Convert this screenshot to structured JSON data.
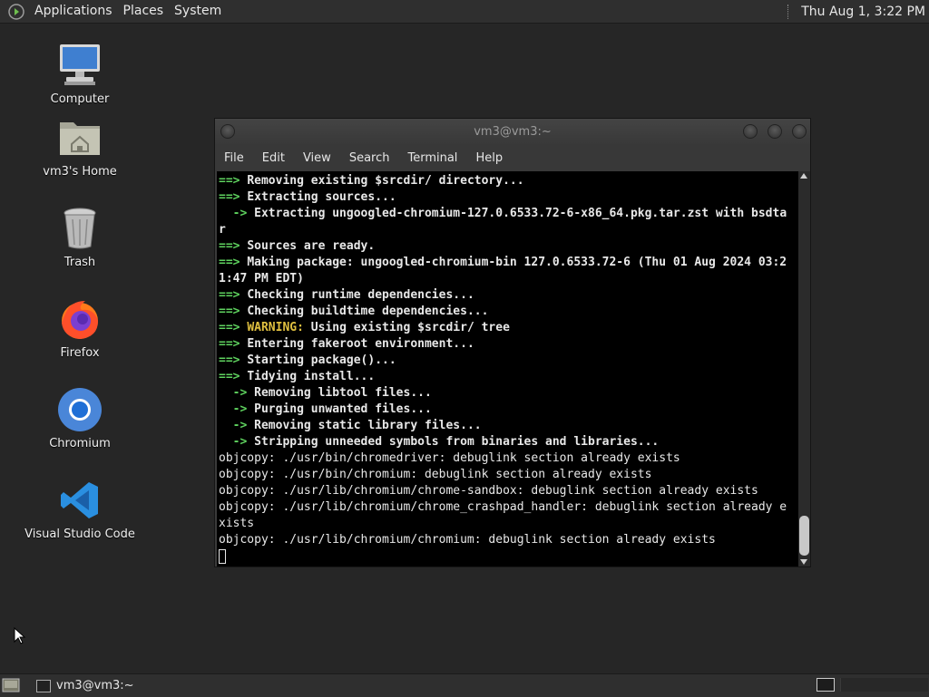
{
  "top_panel": {
    "menus": [
      "Applications",
      "Places",
      "System"
    ],
    "clock": "Thu Aug  1,  3:22 PM"
  },
  "desktop_icons": [
    {
      "label": "Computer",
      "icon": "computer-icon"
    },
    {
      "label": "vm3's Home",
      "icon": "home-folder-icon"
    },
    {
      "label": "Trash",
      "icon": "trash-icon"
    },
    {
      "label": "Firefox",
      "icon": "firefox-icon"
    },
    {
      "label": "Chromium",
      "icon": "chromium-icon"
    },
    {
      "label": "Visual Studio Code",
      "icon": "vscode-icon"
    }
  ],
  "terminal": {
    "title": "vm3@vm3:~",
    "menu": [
      "File",
      "Edit",
      "View",
      "Search",
      "Terminal",
      "Help"
    ],
    "lines": [
      {
        "prefix": "==> ",
        "kind": "main",
        "text": "Removing existing $srcdir/ directory..."
      },
      {
        "prefix": "==> ",
        "kind": "main",
        "text": "Extracting sources..."
      },
      {
        "prefix": "  -> ",
        "kind": "sub",
        "text": "Extracting ungoogled-chromium-127.0.6533.72-6-x86_64.pkg.tar.zst with bsdta"
      },
      {
        "prefix": "",
        "kind": "cont",
        "text": "r"
      },
      {
        "prefix": "==> ",
        "kind": "main",
        "text": "Sources are ready."
      },
      {
        "prefix": "==> ",
        "kind": "main",
        "text": "Making package: ungoogled-chromium-bin 127.0.6533.72-6 (Thu 01 Aug 2024 03:2"
      },
      {
        "prefix": "",
        "kind": "cont",
        "text": "1:47 PM EDT)"
      },
      {
        "prefix": "==> ",
        "kind": "main",
        "text": "Checking runtime dependencies..."
      },
      {
        "prefix": "==> ",
        "kind": "main",
        "text": "Checking buildtime dependencies..."
      },
      {
        "prefix": "==> ",
        "kind": "warning",
        "warn_label": "WARNING:",
        "text": " Using existing $srcdir/ tree"
      },
      {
        "prefix": "==> ",
        "kind": "main",
        "text": "Entering fakeroot environment..."
      },
      {
        "prefix": "==> ",
        "kind": "main",
        "text": "Starting package()..."
      },
      {
        "prefix": "==> ",
        "kind": "main",
        "text": "Tidying install..."
      },
      {
        "prefix": "  -> ",
        "kind": "sub",
        "text": "Removing libtool files..."
      },
      {
        "prefix": "  -> ",
        "kind": "sub",
        "text": "Purging unwanted files..."
      },
      {
        "prefix": "  -> ",
        "kind": "sub",
        "text": "Removing static library files..."
      },
      {
        "prefix": "  -> ",
        "kind": "sub",
        "text": "Stripping unneeded symbols from binaries and libraries..."
      },
      {
        "prefix": "",
        "kind": "plain",
        "text": "objcopy: ./usr/bin/chromedriver: debuglink section already exists"
      },
      {
        "prefix": "",
        "kind": "plain",
        "text": "objcopy: ./usr/bin/chromium: debuglink section already exists"
      },
      {
        "prefix": "",
        "kind": "plain",
        "text": "objcopy: ./usr/lib/chromium/chrome-sandbox: debuglink section already exists"
      },
      {
        "prefix": "",
        "kind": "plain",
        "text": "objcopy: ./usr/lib/chromium/chrome_crashpad_handler: debuglink section already e"
      },
      {
        "prefix": "",
        "kind": "plain",
        "text": "xists"
      },
      {
        "prefix": "",
        "kind": "plain",
        "text": "objcopy: ./usr/lib/chromium/chromium: debuglink section already exists"
      }
    ]
  },
  "taskbar": {
    "items": [
      {
        "label": "vm3@vm3:~"
      }
    ]
  },
  "colors": {
    "arrow": "#5fd35f",
    "warning": "#e0c040",
    "terminal_bg": "#000000",
    "desktop_bg": "#262626"
  }
}
